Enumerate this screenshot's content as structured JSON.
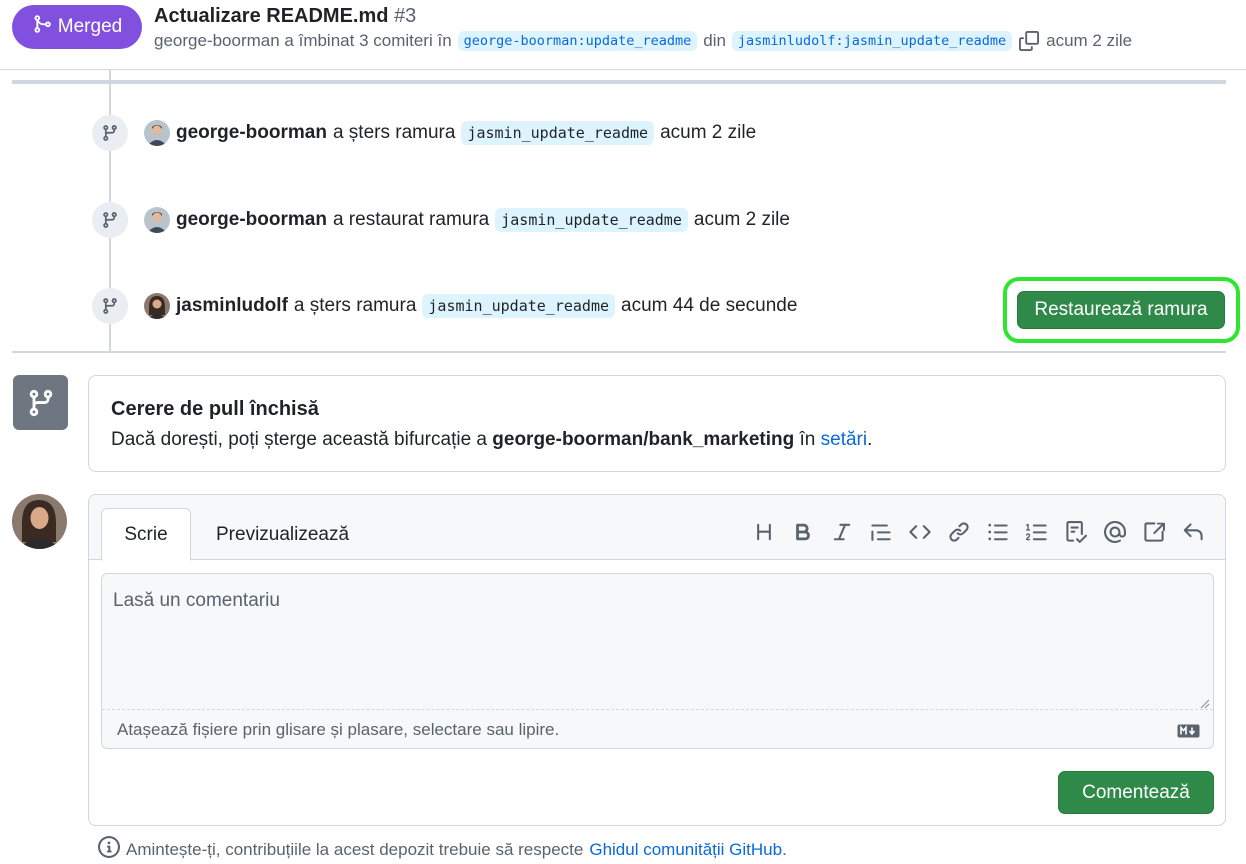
{
  "header": {
    "status_label": "Merged",
    "title": "Actualizare README.md",
    "number": "#3",
    "meta_prefix": "george-boorman a îmbinat 3 comiteri în",
    "base_branch": "george-boorman:update_readme",
    "meta_from": "din",
    "head_branch": "jasminludolf:jasmin_update_readme",
    "meta_time": "acum 2 zile"
  },
  "timeline": [
    {
      "user": "george-boorman",
      "action": "a șters ramura",
      "branch": "jasmin_update_readme",
      "time": "acum 2 zile"
    },
    {
      "user": "george-boorman",
      "action": "a restaurat ramura",
      "branch": "jasmin_update_readme",
      "time": "acum 2 zile"
    },
    {
      "user": "jasminludolf",
      "action": "a șters ramura",
      "branch": "jasmin_update_readme",
      "time": "acum 44 de secunde"
    }
  ],
  "restore_button": "Restaurează ramura",
  "closed": {
    "title": "Cerere de pull închisă",
    "desc_prefix": "Dacă dorești, poți șterge această bifurcație a",
    "repo": "george-boorman/bank_marketing",
    "desc_in": "în",
    "settings_link": "setări",
    "desc_suffix": "."
  },
  "editor": {
    "tab_write": "Scrie",
    "tab_preview": "Previzualizează",
    "placeholder": "Lasă un comentariu",
    "attach_hint": "Atașează fișiere prin glisare și plasare, selectare sau lipire.",
    "submit": "Comentează",
    "toolbar_icons": [
      "heading-icon",
      "bold-icon",
      "italic-icon",
      "quote-icon",
      "code-icon",
      "link-icon",
      "bulleted-list-icon",
      "numbered-list-icon",
      "task-list-icon",
      "mention-icon",
      "reference-icon",
      "reply-icon"
    ]
  },
  "footer": {
    "prefix": "Amintește-ți, contribuțiile la acest depozit trebuie să respecte",
    "link": "Ghidul comunității GitHub",
    "suffix": "."
  },
  "colors": {
    "merged": "#8250df",
    "primary_button": "#2f8a4a",
    "highlight_ring": "#2ee62e",
    "link": "#0969da",
    "branch_bg": "#ddf4ff"
  }
}
